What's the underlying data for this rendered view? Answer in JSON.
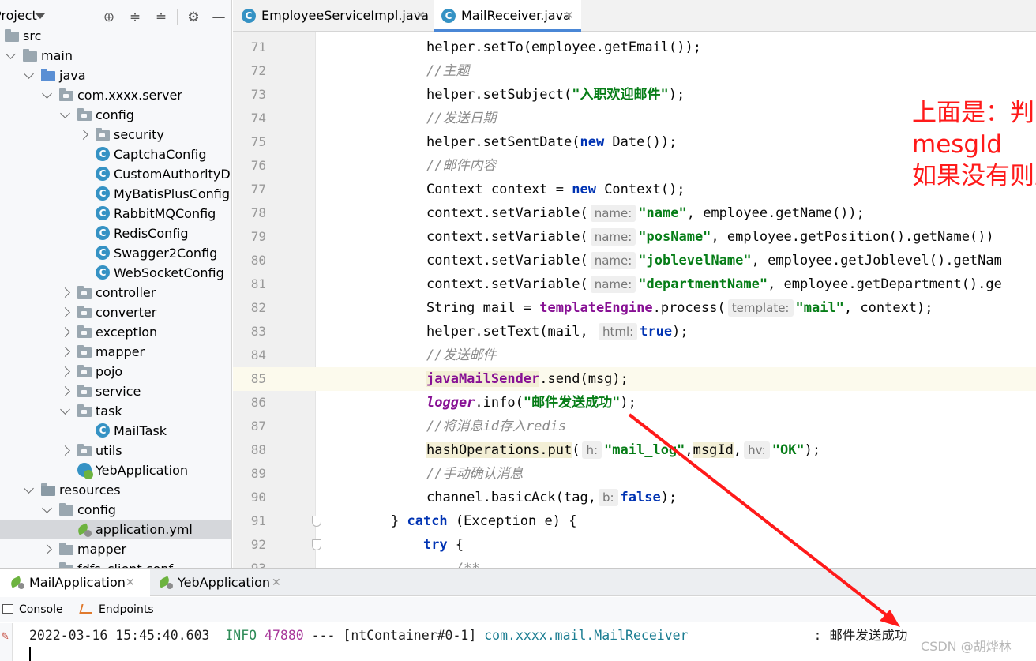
{
  "project": {
    "header_label": "Project",
    "tree": [
      {
        "label": "src",
        "indent": 0,
        "chev": "down",
        "icon": "folder"
      },
      {
        "label": "main",
        "indent": 1,
        "chev": "down",
        "icon": "folder"
      },
      {
        "label": "java",
        "indent": 2,
        "chev": "down",
        "icon": "folder-src"
      },
      {
        "label": "com.xxxx.server",
        "indent": 3,
        "chev": "down",
        "icon": "package"
      },
      {
        "label": "config",
        "indent": 4,
        "chev": "down",
        "icon": "package"
      },
      {
        "label": "security",
        "indent": 5,
        "chev": "right",
        "icon": "package"
      },
      {
        "label": "CaptchaConfig",
        "indent": 5,
        "chev": "none",
        "icon": "class"
      },
      {
        "label": "CustomAuthorityD",
        "indent": 5,
        "chev": "none",
        "icon": "class"
      },
      {
        "label": "MyBatisPlusConfig",
        "indent": 5,
        "chev": "none",
        "icon": "class"
      },
      {
        "label": "RabbitMQConfig",
        "indent": 5,
        "chev": "none",
        "icon": "class"
      },
      {
        "label": "RedisConfig",
        "indent": 5,
        "chev": "none",
        "icon": "class"
      },
      {
        "label": "Swagger2Config",
        "indent": 5,
        "chev": "none",
        "icon": "class"
      },
      {
        "label": "WebSocketConfig",
        "indent": 5,
        "chev": "none",
        "icon": "class"
      },
      {
        "label": "controller",
        "indent": 4,
        "chev": "right",
        "icon": "package"
      },
      {
        "label": "converter",
        "indent": 4,
        "chev": "right",
        "icon": "package"
      },
      {
        "label": "exception",
        "indent": 4,
        "chev": "right",
        "icon": "package"
      },
      {
        "label": "mapper",
        "indent": 4,
        "chev": "right",
        "icon": "package"
      },
      {
        "label": "pojo",
        "indent": 4,
        "chev": "right",
        "icon": "package"
      },
      {
        "label": "service",
        "indent": 4,
        "chev": "right",
        "icon": "package"
      },
      {
        "label": "task",
        "indent": 4,
        "chev": "down",
        "icon": "package"
      },
      {
        "label": "MailTask",
        "indent": 5,
        "chev": "none",
        "icon": "class"
      },
      {
        "label": "utils",
        "indent": 4,
        "chev": "right",
        "icon": "package"
      },
      {
        "label": "YebApplication",
        "indent": 4,
        "chev": "none",
        "icon": "boot"
      },
      {
        "label": "resources",
        "indent": 2,
        "chev": "down",
        "icon": "folder-res"
      },
      {
        "label": "config",
        "indent": 3,
        "chev": "down",
        "icon": "folder"
      },
      {
        "label": "application.yml",
        "indent": 4,
        "chev": "none",
        "icon": "yml",
        "selected": true
      },
      {
        "label": "mapper",
        "indent": 3,
        "chev": "right",
        "icon": "folder"
      },
      {
        "label": "fdfs_client.conf",
        "indent": 3,
        "chev": "none",
        "icon": "file"
      }
    ]
  },
  "editor": {
    "tabs": [
      {
        "label": "EmployeeServiceImpl.java",
        "active": false
      },
      {
        "label": "MailReceiver.java",
        "active": true
      }
    ],
    "lines": [
      {
        "n": "71",
        "ind": 4,
        "t": [
          [
            "p",
            "helper.setTo(employee.getEmail());"
          ]
        ]
      },
      {
        "n": "72",
        "ind": 4,
        "t": [
          [
            "c",
            "//主题"
          ]
        ]
      },
      {
        "n": "73",
        "ind": 4,
        "t": [
          [
            "p",
            "helper.setSubject("
          ],
          [
            "s",
            "\"入职欢迎邮件\""
          ],
          [
            "p",
            ");"
          ]
        ]
      },
      {
        "n": "74",
        "ind": 4,
        "t": [
          [
            "c",
            "//发送日期"
          ]
        ]
      },
      {
        "n": "75",
        "ind": 4,
        "t": [
          [
            "p",
            "helper.setSentDate("
          ],
          [
            "k",
            "new"
          ],
          [
            "p",
            " Date());"
          ]
        ]
      },
      {
        "n": "76",
        "ind": 4,
        "t": [
          [
            "c",
            "//邮件内容"
          ]
        ]
      },
      {
        "n": "77",
        "ind": 4,
        "t": [
          [
            "p",
            "Context context = "
          ],
          [
            "k",
            "new"
          ],
          [
            "p",
            " Context();"
          ]
        ]
      },
      {
        "n": "78",
        "ind": 4,
        "t": [
          [
            "p",
            "context.setVariable("
          ],
          [
            "hint",
            "name:"
          ],
          [
            "s",
            "\"name\""
          ],
          [
            "p",
            ", employee.getName());"
          ]
        ]
      },
      {
        "n": "79",
        "ind": 4,
        "t": [
          [
            "p",
            "context.setVariable("
          ],
          [
            "hint",
            "name:"
          ],
          [
            "s",
            "\"posName\""
          ],
          [
            "p",
            ", employee.getPosition().getName())"
          ]
        ]
      },
      {
        "n": "80",
        "ind": 4,
        "t": [
          [
            "p",
            "context.setVariable("
          ],
          [
            "hint",
            "name:"
          ],
          [
            "s",
            "\"joblevelName\""
          ],
          [
            "p",
            ", employee.getJoblevel().getNam"
          ]
        ]
      },
      {
        "n": "81",
        "ind": 4,
        "t": [
          [
            "p",
            "context.setVariable("
          ],
          [
            "hint",
            "name:"
          ],
          [
            "s",
            "\"departmentName\""
          ],
          [
            "p",
            ", employee.getDepartment().ge"
          ]
        ]
      },
      {
        "n": "82",
        "ind": 4,
        "t": [
          [
            "p",
            "String mail = "
          ],
          [
            "f",
            "templateEngine"
          ],
          [
            "p",
            ".process("
          ],
          [
            "hint",
            "template:"
          ],
          [
            "s",
            "\"mail\""
          ],
          [
            "p",
            ", context);"
          ]
        ]
      },
      {
        "n": "83",
        "ind": 4,
        "t": [
          [
            "p",
            "helper.setText(mail, "
          ],
          [
            "hint",
            "html:"
          ],
          [
            "k",
            "true"
          ],
          [
            "p",
            ");"
          ]
        ]
      },
      {
        "n": "84",
        "ind": 4,
        "t": [
          [
            "c",
            "//发送邮件"
          ]
        ]
      },
      {
        "n": "85",
        "ind": 4,
        "current": true,
        "t": [
          [
            "fhl",
            "javaMailSender"
          ],
          [
            "p",
            ".send(msg);"
          ]
        ]
      },
      {
        "n": "86",
        "ind": 4,
        "t": [
          [
            "fi",
            "logger"
          ],
          [
            "p",
            ".info("
          ],
          [
            "s",
            "\"邮件发送成功\""
          ],
          [
            "p",
            ");"
          ]
        ]
      },
      {
        "n": "87",
        "ind": 4,
        "t": [
          [
            "c",
            "//将消息id存入redis"
          ]
        ]
      },
      {
        "n": "88",
        "ind": 4,
        "t": [
          [
            "phl",
            "hashOperations.put"
          ],
          [
            "p",
            "("
          ],
          [
            "hint",
            "h:"
          ],
          [
            "s",
            "\"mail_log\""
          ],
          [
            "p",
            ","
          ],
          [
            "phl",
            "msgId"
          ],
          [
            "p",
            ","
          ],
          [
            "hint",
            "hv:"
          ],
          [
            "s",
            "\"OK\""
          ],
          [
            "p",
            ");"
          ]
        ]
      },
      {
        "n": "89",
        "ind": 4,
        "t": [
          [
            "c",
            "//手动确认消息"
          ]
        ]
      },
      {
        "n": "90",
        "ind": 4,
        "t": [
          [
            "p",
            "channel.basicAck(tag,"
          ],
          [
            "hint",
            "b:"
          ],
          [
            "k",
            "false"
          ],
          [
            "p",
            ");"
          ]
        ]
      },
      {
        "n": "91",
        "ind": 0,
        "fold": true,
        "t": [
          [
            "p",
            "} "
          ],
          [
            "k",
            "catch"
          ],
          [
            "p",
            " (Exception e) {"
          ]
        ]
      },
      {
        "n": "92",
        "ind": 0,
        "fold": true,
        "t": [
          [
            "p",
            "    "
          ],
          [
            "k",
            "try"
          ],
          [
            "p",
            " {"
          ]
        ]
      },
      {
        "n": "93",
        "ind": 0,
        "t": [
          [
            "p",
            "        "
          ],
          [
            "c",
            "/**"
          ]
        ]
      }
    ],
    "annotation": "上面是：判断redis中有没有\nmesgId\n如果没有则正常进行发送邮件"
  },
  "run": {
    "tabs": [
      {
        "label": "MailApplication",
        "active": true
      },
      {
        "label": "YebApplication",
        "active": false
      }
    ],
    "toolbar": {
      "console": "Console",
      "endpoints": "Endpoints"
    },
    "log": {
      "timestamp": "2022-03-16 15:45:40.603",
      "level": "INFO",
      "pid": "47880",
      "sep": "---",
      "thread": "[ntContainer#0-1]",
      "logger": "com.xxxx.mail.MailReceiver",
      "colon": ":",
      "message": "邮件发送成功"
    }
  },
  "watermark": "CSDN @胡烨林",
  "colors": {
    "annotation": "#ff1a1a",
    "keyword": "#0033b3",
    "string": "#067d17",
    "field": "#871094",
    "comment": "#8c8c8c"
  }
}
